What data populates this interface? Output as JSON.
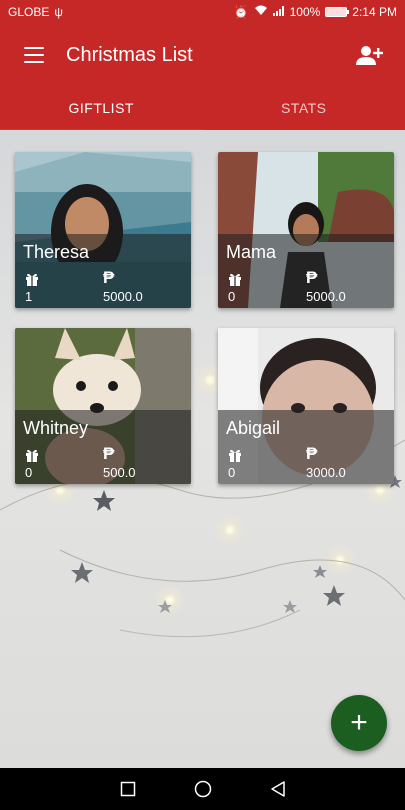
{
  "status_bar": {
    "carrier": "GLOBE",
    "usb_icon": "usb-icon",
    "battery": "100%",
    "time": "2:14 PM"
  },
  "app_bar": {
    "title": "Christmas List",
    "menu_icon": "menu-icon",
    "action_icon": "add-person-icon"
  },
  "tabs": [
    {
      "label": "GIFTLIST",
      "active": true
    },
    {
      "label": "STATS",
      "active": false
    }
  ],
  "people": [
    {
      "name": "Theresa",
      "gifts": "1",
      "currency": "₱",
      "amount": "5000.0"
    },
    {
      "name": "Mama",
      "gifts": "0",
      "currency": "₱",
      "amount": "5000.0"
    },
    {
      "name": "Whitney",
      "gifts": "0",
      "currency": "₱",
      "amount": "500.0"
    },
    {
      "name": "Abigail",
      "gifts": "0",
      "currency": "₱",
      "amount": "3000.0"
    }
  ],
  "fab": {
    "label": "+"
  },
  "colors": {
    "primary": "#c62828",
    "tab_indicator": "#e91e63",
    "fab": "#1b5e20"
  }
}
